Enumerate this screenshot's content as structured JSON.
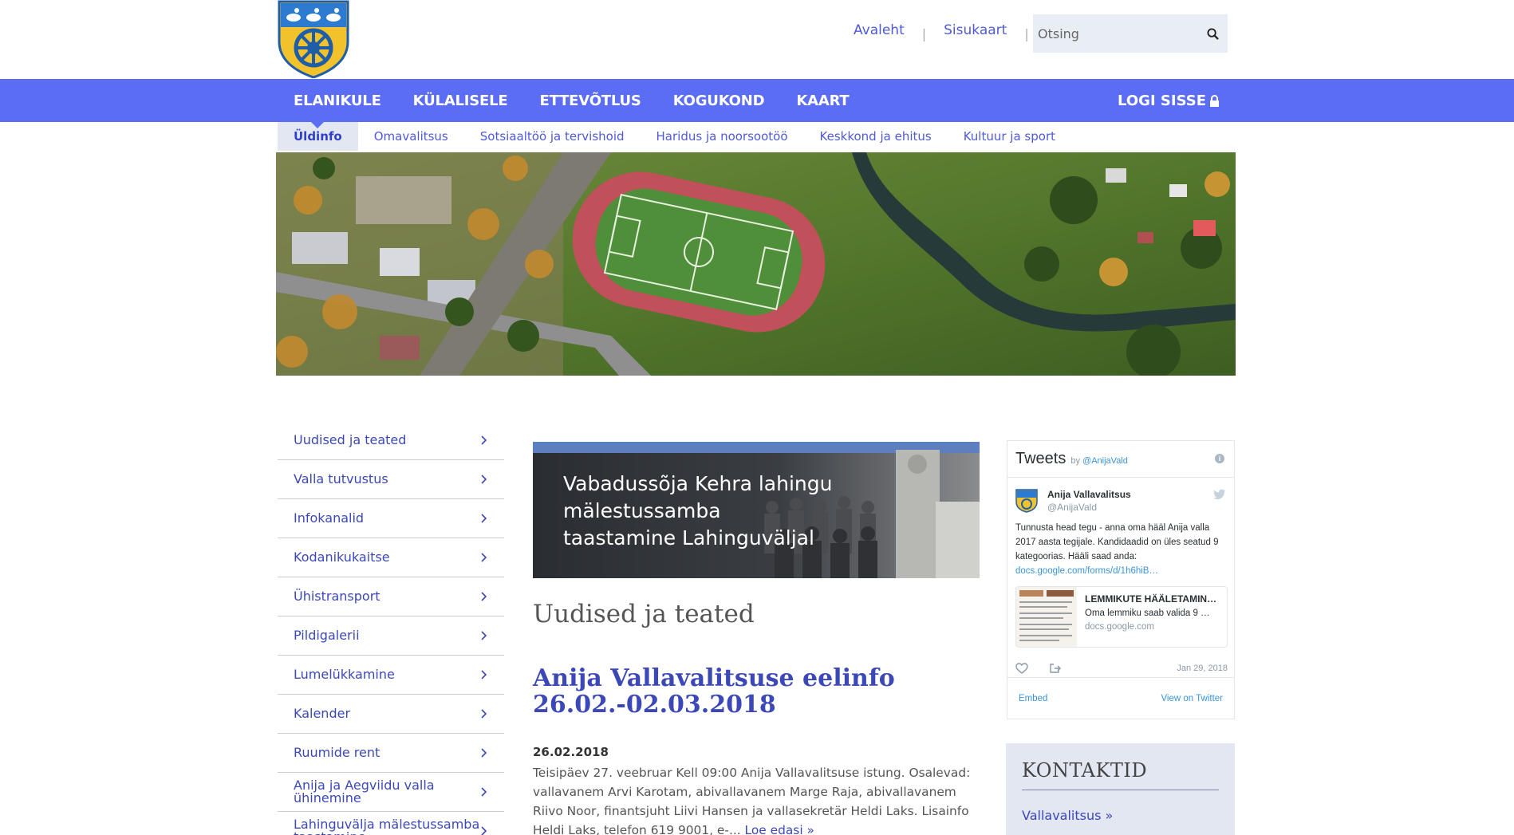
{
  "header": {
    "top_links": [
      "Avaleht",
      "Sisukaart"
    ],
    "separator": "|",
    "search_placeholder": "Otsing"
  },
  "main_nav": {
    "items": [
      "ELANIKULE",
      "KÜLALISELE",
      "ETTEVÕTLUS",
      "KOGUKOND",
      "KAART"
    ],
    "login_label": "LOGI SISSE"
  },
  "sub_nav": {
    "items": [
      "Üldinfo",
      "Omavalitsus",
      "Sotsiaaltöö ja tervishoid",
      "Haridus ja noorsootöö",
      "Keskkond ja ehitus",
      "Kultuur ja sport"
    ],
    "active": "Üldinfo"
  },
  "sidebar": {
    "items": [
      "Uudised ja teated",
      "Valla tutvustus",
      "Infokanalid",
      "Kodanikukaitse",
      "Ühistransport",
      "Pildigalerii",
      "Lumelükkamine",
      "Kalender",
      "Ruumide rent",
      "Anija ja Aegviidu valla ühinemine",
      "Lahinguvälja mälestussamba taastamine"
    ]
  },
  "banner": {
    "title": "Vabadussõja Kehra lahingu mälestussamba taastamine Lahinguväljal"
  },
  "news": {
    "section_title": "Uudised ja teated",
    "article_title": "Anija Vallavalitsuse eelinfo 26.02.-02.03.2018",
    "date": "26.02.2018",
    "body": "Teisipäev 27. veebruar Kell 09:00 Anija Vallavalitsuse istung. Osalevad: vallavanem Arvi Karotam, abivallavanem Marge Raja, abivallavanem Riivo Noor, finantsjuht Liivi Hansen ja vallasekretär Heldi Laks. Lisainfo Heldi Laks, telefon 619 9001, e-...",
    "read_more": "Loe edasi »"
  },
  "tweets": {
    "title": "Tweets",
    "by": "by",
    "handle_link": "@AnijaVald",
    "user_name": "Anija Vallavalitsus",
    "user_handle": "@AnijaVald",
    "text": "Tunnusta head tegu - anna oma hääl Anija valla 2017 aasta tegijale. Kandidaadid on üles seatud 9 kategoorias. Hääli saad anda:",
    "link": "docs.google.com/forms/d/1h6hiB…",
    "card_title": "LEMMIKUTE HÄÄLETAMIN…",
    "card_desc": "Oma lemmiku saab valida 9 …",
    "card_domain": "docs.google.com",
    "date": "Jan 29, 2018",
    "embed": "Embed",
    "view_on": "View on Twitter"
  },
  "contacts": {
    "title": "KONTAKTID",
    "link": "Vallavalitsus »"
  },
  "colors": {
    "nav_blue": "#5b6cf5",
    "link_blue": "#3c48b8",
    "sub_active_bg": "#e2e7f2"
  }
}
